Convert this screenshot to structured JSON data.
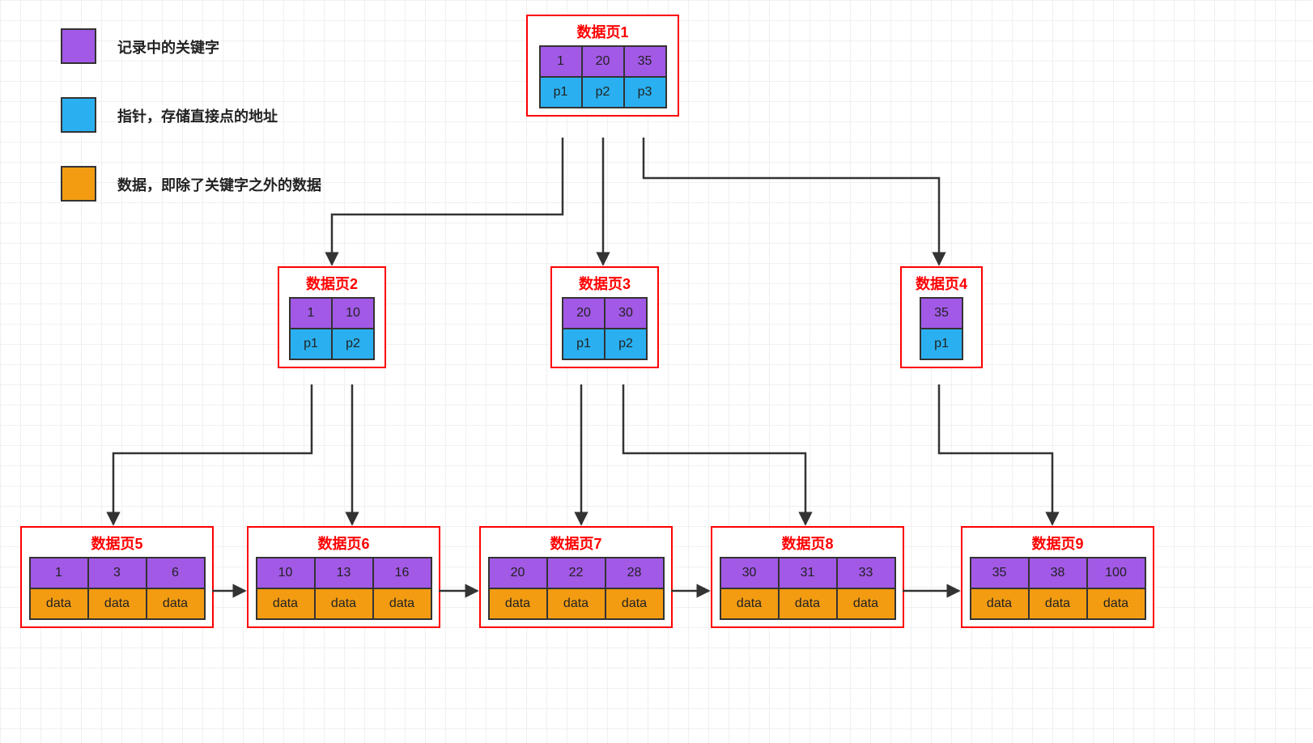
{
  "legend": {
    "key_label": "记录中的关键字",
    "ptr_label": "指针，存储直接点的地址",
    "data_label": "数据，即除了关键字之外的数据"
  },
  "pages": {
    "p1": {
      "title": "数据页1",
      "keys": [
        "1",
        "20",
        "35"
      ],
      "ptrs": [
        "p1",
        "p2",
        "p3"
      ]
    },
    "p2": {
      "title": "数据页2",
      "keys": [
        "1",
        "10"
      ],
      "ptrs": [
        "p1",
        "p2"
      ]
    },
    "p3": {
      "title": "数据页3",
      "keys": [
        "20",
        "30"
      ],
      "ptrs": [
        "p1",
        "p2"
      ]
    },
    "p4": {
      "title": "数据页4",
      "keys": [
        "35"
      ],
      "ptrs": [
        "p1"
      ]
    },
    "p5": {
      "title": "数据页5",
      "keys": [
        "1",
        "3",
        "6"
      ],
      "data": [
        "data",
        "data",
        "data"
      ]
    },
    "p6": {
      "title": "数据页6",
      "keys": [
        "10",
        "13",
        "16"
      ],
      "data": [
        "data",
        "data",
        "data"
      ]
    },
    "p7": {
      "title": "数据页7",
      "keys": [
        "20",
        "22",
        "28"
      ],
      "data": [
        "data",
        "data",
        "data"
      ]
    },
    "p8": {
      "title": "数据页8",
      "keys": [
        "30",
        "31",
        "33"
      ],
      "data": [
        "data",
        "data",
        "data"
      ]
    },
    "p9": {
      "title": "数据页9",
      "keys": [
        "35",
        "38",
        "100"
      ],
      "data": [
        "data",
        "data",
        "data"
      ]
    }
  },
  "colors": {
    "key": "#a259e6",
    "ptr": "#2ab0f0",
    "data": "#f39c12",
    "border": "#333333",
    "pageBorder": "red"
  }
}
